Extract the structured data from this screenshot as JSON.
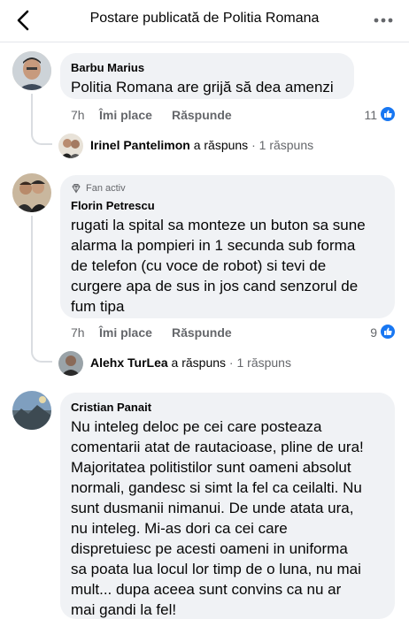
{
  "header": {
    "title": "Postare publicată de Politia Romana",
    "back_icon": "chevron-left-icon",
    "more_icon": "more-horizontal-icon"
  },
  "comments": [
    {
      "author": "Barbu Marius",
      "text": "Politia Romana are grijă să dea amenzi",
      "time": "7h",
      "like_label": "Îmi place",
      "reply_label": "Răspunde",
      "reactions": "11",
      "reply_preview": {
        "author": "Irinel Pantelimon",
        "verb": "a răspuns",
        "sep": "·",
        "count": "1 răspuns"
      }
    },
    {
      "badge": "Fan activ",
      "author": "Florin Petrescu",
      "text_lines": [
        "rugati la spital sa monteze un buton sa sune",
        "alarma la pompieri in 1 secunda sub forma",
        "de telefon (cu voce de robot) si tevi de",
        "curgere apa de sus in jos cand senzorul de",
        "fum tipa"
      ],
      "time": "7h",
      "like_label": "Îmi place",
      "reply_label": "Răspunde",
      "reactions": "9",
      "reply_preview": {
        "author": "Alehx TurLea",
        "verb": "a răspuns",
        "sep": "·",
        "count": "1 răspuns"
      }
    },
    {
      "author": "Cristian Panait",
      "text_lines": [
        "Nu inteleg deloc pe cei care posteaza",
        "comentarii atat de rautacioase, pline de ura!",
        "Majoritatea politistilor sunt oameni absolut",
        "normali, gandesc si simt la fel ca ceilalti. Nu",
        "sunt dusmanii nimanui. De unde atata ura,",
        "nu inteleg. Mi-as dori ca cei care",
        "dispretuiesc pe acesti oameni in uniforma",
        "sa poata lua locul lor timp de o luna, nu mai",
        "mult... dupa aceea sunt convins ca nu ar",
        "mai gandi la fel!"
      ]
    }
  ],
  "colors": {
    "like_blue": "#1877f2",
    "bubble": "#f0f2f5",
    "muted": "#65676b"
  }
}
